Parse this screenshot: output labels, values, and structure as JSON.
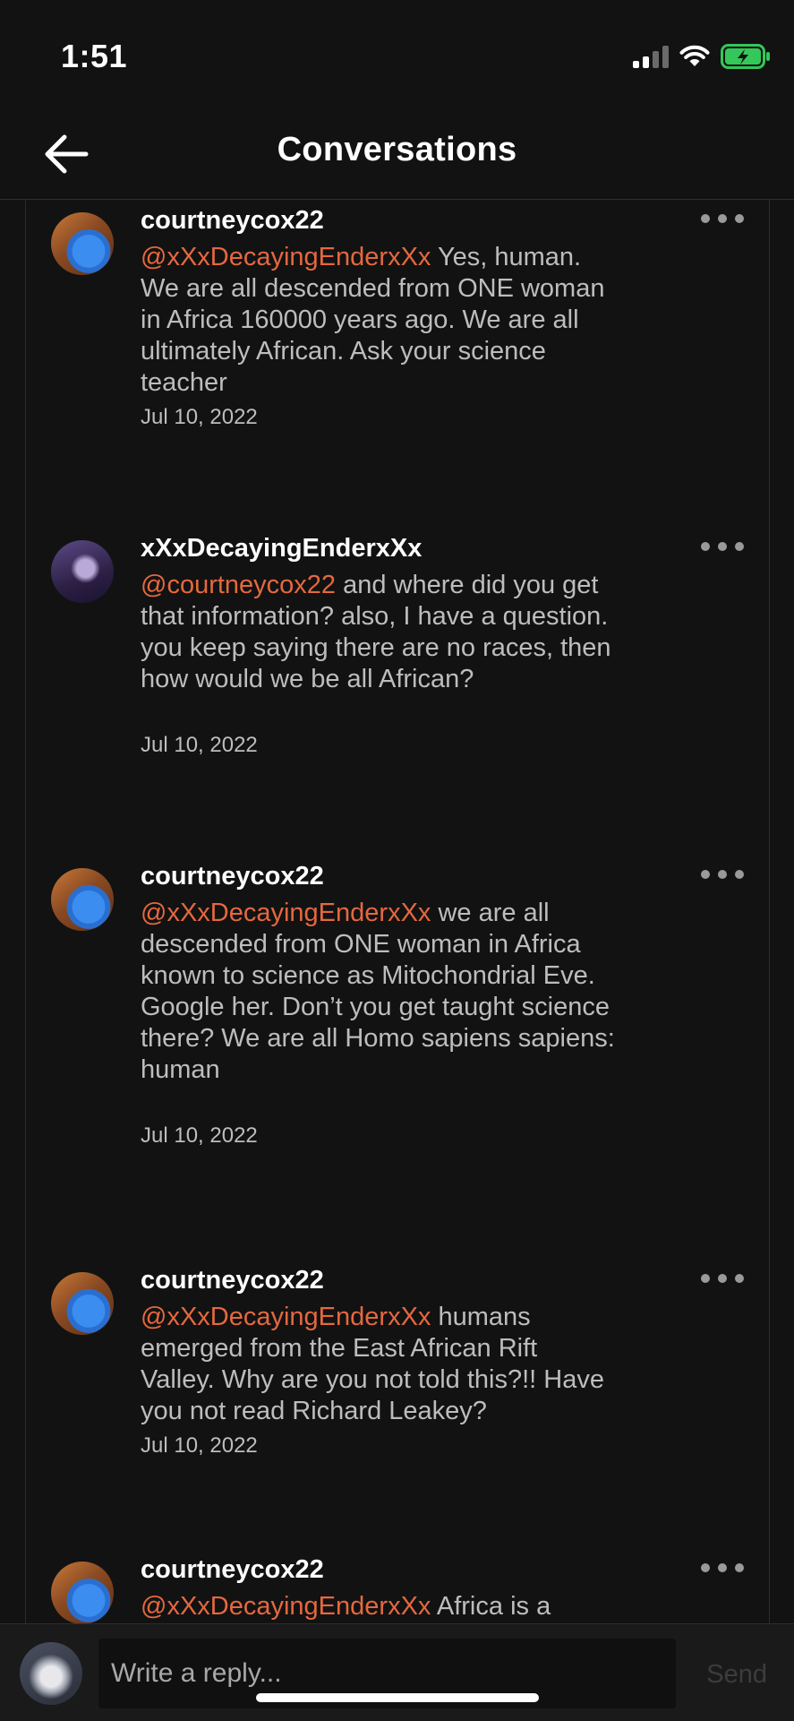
{
  "status_bar": {
    "time": "1:51"
  },
  "header": {
    "title": "Conversations"
  },
  "comments": [
    {
      "username": "courtneycox22",
      "mention": "@xXxDecayingEnderxXx",
      "text": "  Yes, human. We are all descended from ONE woman in Africa 160000 years ago. We are all ultimately African. Ask your science teacher",
      "date": "Jul 10, 2022",
      "avatar": "arch-avatar"
    },
    {
      "username": "xXxDecayingEnderxXx",
      "mention": "@courtneycox22",
      "text": " and where did you get that information?  also, I have a question. you keep saying there are no races, then how would we be all African?",
      "date": "Jul 10, 2022",
      "avatar": "purple-avatar"
    },
    {
      "username": "courtneycox22",
      "mention": "@xXxDecayingEnderxXx",
      "text": " we are all descended from ONE woman in Africa known to science as Mitochondrial Eve. Google her. Don’t you get taught science there? We are all Homo sapiens sapiens: human",
      "date": "Jul 10, 2022",
      "avatar": "arch-avatar"
    },
    {
      "username": "courtneycox22",
      "mention": "@xXxDecayingEnderxXx",
      "text": " humans emerged from the East African Rift Valley. Why are you not told this?!! Have you not read Richard Leakey?",
      "date": "Jul 10, 2022",
      "avatar": "arch-avatar"
    },
    {
      "username": "courtneycox22",
      "mention": "@xXxDecayingEnderxXx",
      "text": " Africa is a",
      "date": "",
      "avatar": "arch-avatar"
    }
  ],
  "reply": {
    "placeholder": "Write a reply...",
    "send_label": "Send"
  },
  "colors": {
    "mention": "#e4683f",
    "background": "#121212",
    "battery": "#34c759"
  }
}
